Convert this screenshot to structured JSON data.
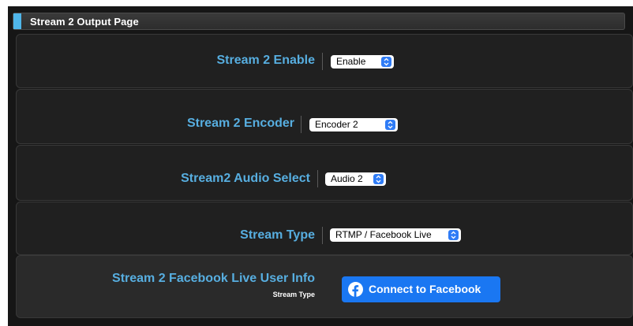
{
  "header": {
    "title": "Stream 2 Output Page"
  },
  "rows": [
    {
      "label": "Stream 2 Enable",
      "select_value": "Enable"
    },
    {
      "label": "Stream 2 Encoder",
      "select_value": "Encoder 2"
    },
    {
      "label": "Stream2 Audio Select",
      "select_value": "Audio 2"
    },
    {
      "label": "Stream Type",
      "select_value": "RTMP / Facebook Live"
    }
  ],
  "facebook": {
    "label": "Stream 2 Facebook Live User Info",
    "sublabel": "Stream Type",
    "button_label": "Connect to Facebook",
    "icon": "facebook-icon"
  },
  "colors": {
    "accent": "#4fb6ea",
    "label": "#57aee0",
    "facebook_blue": "#1a77f2",
    "select_arrow": "#2f7cf6"
  }
}
